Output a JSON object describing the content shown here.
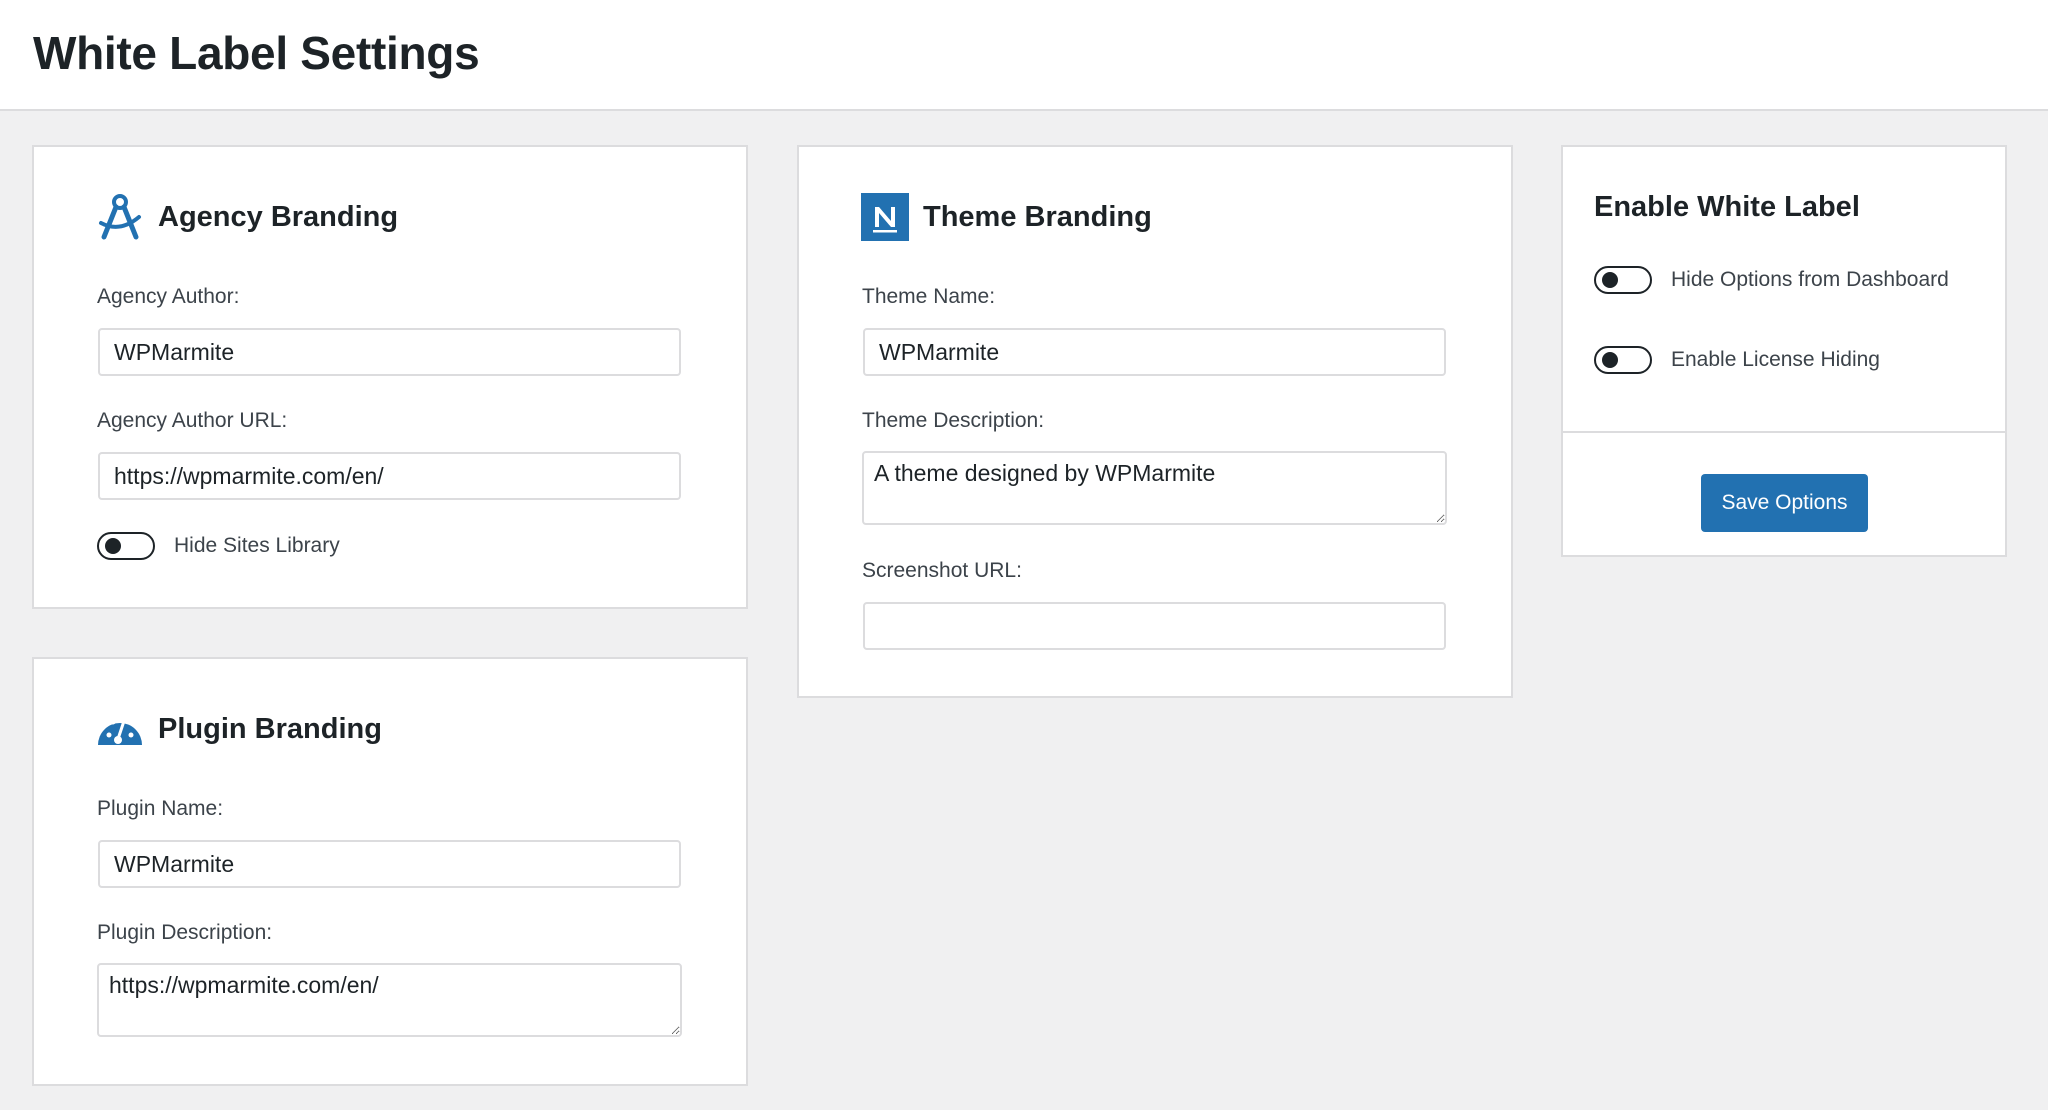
{
  "page": {
    "title": "White Label Settings"
  },
  "agency": {
    "title": "Agency Branding",
    "icon": "compass-icon",
    "author_label": "Agency Author:",
    "author_value": "WPMarmite",
    "author_url_label": "Agency Author URL:",
    "author_url_value": "https://wpmarmite.com/en/",
    "hide_sites_library_label": "Hide Sites Library",
    "hide_sites_library_on": false
  },
  "plugin": {
    "title": "Plugin Branding",
    "icon": "dashboard-gauge-icon",
    "name_label": "Plugin Name:",
    "name_value": "WPMarmite",
    "description_label": "Plugin Description:",
    "description_value": "https://wpmarmite.com/en/"
  },
  "theme": {
    "title": "Theme Branding",
    "icon": "neve-n-logo-icon",
    "name_label": "Theme Name:",
    "name_value": "WPMarmite",
    "description_label": "Theme Description:",
    "description_value": "A theme designed by WPMarmite",
    "screenshot_url_label": "Screenshot URL:",
    "screenshot_url_value": ""
  },
  "enable": {
    "title": "Enable White Label",
    "hide_options_label": "Hide Options from Dashboard",
    "hide_options_on": false,
    "license_hiding_label": "Enable License Hiding",
    "license_hiding_on": false,
    "save_label": "Save Options"
  },
  "colors": {
    "accent": "#2271b1",
    "page_background": "#f0f0f1",
    "border": "#dcdcde",
    "text": "#1d2327"
  }
}
